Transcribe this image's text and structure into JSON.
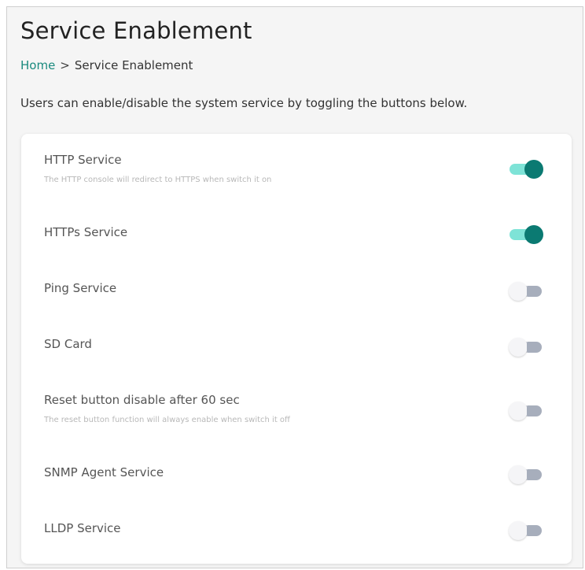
{
  "page": {
    "title": "Service Enablement",
    "breadcrumb": {
      "home": "Home",
      "separator": ">",
      "current": "Service Enablement"
    },
    "description": "Users can enable/disable the system service by toggling the buttons below."
  },
  "colors": {
    "accent": "#0b7a72",
    "accent_light": "#7ee3d7",
    "link": "#1a8a7e",
    "toggle_off": "#a7aebc"
  },
  "services": [
    {
      "name": "HTTP Service",
      "description": "The HTTP console will redirect to HTTPS when switch it on",
      "enabled": true
    },
    {
      "name": "HTTPs Service",
      "description": "",
      "enabled": true
    },
    {
      "name": "Ping Service",
      "description": "",
      "enabled": false
    },
    {
      "name": "SD Card",
      "description": "",
      "enabled": false
    },
    {
      "name": "Reset button disable after 60 sec",
      "description": "The reset button function will always enable when switch it off",
      "enabled": false
    },
    {
      "name": "SNMP Agent Service",
      "description": "",
      "enabled": false
    },
    {
      "name": "LLDP Service",
      "description": "",
      "enabled": false
    }
  ]
}
